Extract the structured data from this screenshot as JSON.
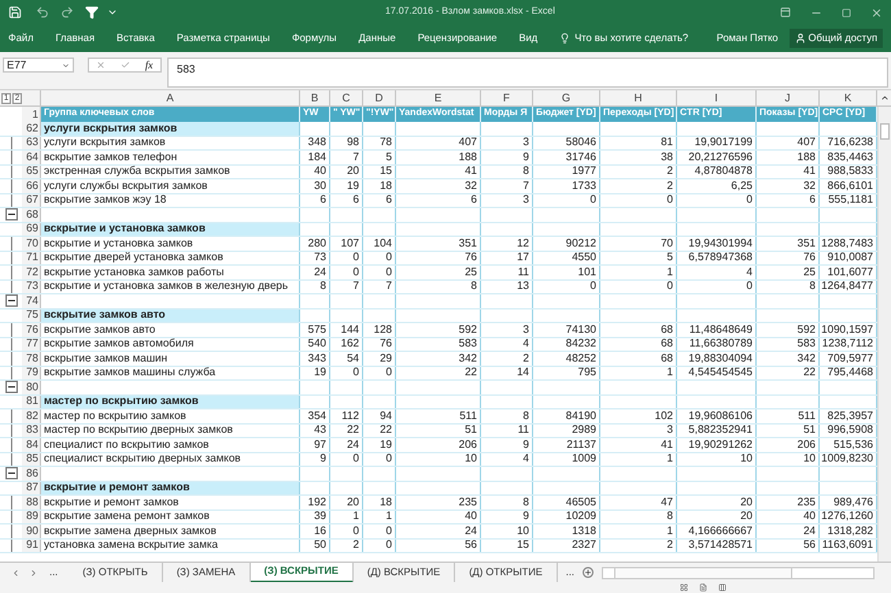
{
  "window": {
    "title": "17.07.2016 - Взлом замков.xlsx - Excel"
  },
  "ribbon": {
    "tabs": [
      "Файл",
      "Главная",
      "Вставка",
      "Разметка страницы",
      "Формулы",
      "Данные",
      "Рецензирование",
      "Вид"
    ],
    "tell_me": "Что вы хотите сделать?",
    "user": "Роман Пятко",
    "share": "Общий доступ"
  },
  "formula_bar": {
    "name_box": "E77",
    "function_label": "fx",
    "formula": "583"
  },
  "outline_levels": [
    "1",
    "2"
  ],
  "columns": [
    "A",
    "B",
    "C",
    "D",
    "E",
    "F",
    "G",
    "H",
    "I",
    "J",
    "K"
  ],
  "header_row": {
    "number": "1",
    "cells": [
      "Группа ключевых слов",
      "YW",
      "\" YW\"",
      "\"!YW\"",
      "YandexWordstat",
      "Морды Я",
      "Бюджет [YD]",
      "Переходы [YD]",
      "CTR [YD]",
      "Показы [YD]",
      "CPC [YD]"
    ]
  },
  "rows": [
    {
      "kind": "group",
      "number": "62",
      "cells": [
        "услуги вскрытия замков"
      ]
    },
    {
      "kind": "item",
      "number": "63",
      "cells": [
        "услуги вскрытия замков",
        "348",
        "98",
        "78",
        "407",
        "3",
        "58046",
        "81",
        "19,9017199",
        "407",
        "716,6238"
      ]
    },
    {
      "kind": "item",
      "number": "64",
      "cells": [
        "вскрытие замков телефон",
        "184",
        "7",
        "5",
        "188",
        "9",
        "31746",
        "38",
        "20,21276596",
        "188",
        "835,4463"
      ]
    },
    {
      "kind": "item",
      "number": "65",
      "cells": [
        "экстренная служба вскрытия замков",
        "40",
        "20",
        "15",
        "41",
        "8",
        "1977",
        "2",
        "4,87804878",
        "41",
        "988,5833"
      ]
    },
    {
      "kind": "item",
      "number": "66",
      "cells": [
        "услуги службы вскрытия замков",
        "30",
        "19",
        "18",
        "32",
        "7",
        "1733",
        "2",
        "6,25",
        "32",
        "866,6101"
      ]
    },
    {
      "kind": "item",
      "number": "67",
      "cells": [
        "вскрытие замков жэу 18",
        "6",
        "6",
        "6",
        "6",
        "3",
        "0",
        "0",
        "0",
        "6",
        "555,1181"
      ]
    },
    {
      "kind": "blank",
      "number": "68"
    },
    {
      "kind": "group",
      "number": "69",
      "cells": [
        "вскрытие и установка замков"
      ]
    },
    {
      "kind": "item",
      "number": "70",
      "cells": [
        "вскрытие и установка замков",
        "280",
        "107",
        "104",
        "351",
        "12",
        "90212",
        "70",
        "19,94301994",
        "351",
        "1288,7483"
      ]
    },
    {
      "kind": "item",
      "number": "71",
      "cells": [
        "вскрытие дверей установка замков",
        "73",
        "0",
        "0",
        "76",
        "17",
        "4550",
        "5",
        "6,578947368",
        "76",
        "910,0087"
      ]
    },
    {
      "kind": "item",
      "number": "72",
      "cells": [
        "вскрытие установка замков работы",
        "24",
        "0",
        "0",
        "25",
        "11",
        "101",
        "1",
        "4",
        "25",
        "101,6077"
      ]
    },
    {
      "kind": "item",
      "number": "73",
      "cells": [
        "вскрытие и установка замков в железную дверь",
        "8",
        "7",
        "7",
        "8",
        "13",
        "0",
        "0",
        "0",
        "8",
        "1264,8477"
      ]
    },
    {
      "kind": "blank",
      "number": "74"
    },
    {
      "kind": "group",
      "number": "75",
      "cells": [
        "вскрытие замков авто"
      ]
    },
    {
      "kind": "item",
      "number": "76",
      "cells": [
        "вскрытие замков авто",
        "575",
        "144",
        "128",
        "592",
        "3",
        "74130",
        "68",
        "11,48648649",
        "592",
        "1090,1597"
      ]
    },
    {
      "kind": "item",
      "number": "77",
      "cells": [
        "вскрытие замков автомобиля",
        "540",
        "162",
        "76",
        "583",
        "4",
        "84232",
        "68",
        "11,66380789",
        "583",
        "1238,7112"
      ]
    },
    {
      "kind": "item",
      "number": "78",
      "cells": [
        "вскрытие замков машин",
        "343",
        "54",
        "29",
        "342",
        "2",
        "48252",
        "68",
        "19,88304094",
        "342",
        "709,5977"
      ]
    },
    {
      "kind": "item",
      "number": "79",
      "cells": [
        "вскрытие замков машины служба",
        "19",
        "0",
        "0",
        "22",
        "14",
        "795",
        "1",
        "4,545454545",
        "22",
        "795,4468"
      ]
    },
    {
      "kind": "blank",
      "number": "80"
    },
    {
      "kind": "group",
      "number": "81",
      "cells": [
        "мастер по вскрытию замков"
      ]
    },
    {
      "kind": "item",
      "number": "82",
      "cells": [
        "мастер по вскрытию замков",
        "354",
        "112",
        "94",
        "511",
        "8",
        "84190",
        "102",
        "19,96086106",
        "511",
        "825,3957"
      ]
    },
    {
      "kind": "item",
      "number": "83",
      "cells": [
        "мастер по вскрытию дверных замков",
        "43",
        "22",
        "22",
        "51",
        "11",
        "2989",
        "3",
        "5,882352941",
        "51",
        "996,5908"
      ]
    },
    {
      "kind": "item",
      "number": "84",
      "cells": [
        "специалист по вскрытию замков",
        "97",
        "24",
        "19",
        "206",
        "9",
        "21137",
        "41",
        "19,90291262",
        "206",
        "515,536"
      ]
    },
    {
      "kind": "item",
      "number": "85",
      "cells": [
        "специалист вскрытию дверных замков",
        "9",
        "0",
        "0",
        "10",
        "4",
        "1009",
        "1",
        "10",
        "10",
        "1009,8230"
      ]
    },
    {
      "kind": "blank",
      "number": "86"
    },
    {
      "kind": "group",
      "number": "87",
      "cells": [
        "вскрытие и ремонт замков"
      ]
    },
    {
      "kind": "item",
      "number": "88",
      "cells": [
        "вскрытие и ремонт замков",
        "192",
        "20",
        "18",
        "235",
        "8",
        "46505",
        "47",
        "20",
        "235",
        "989,476"
      ]
    },
    {
      "kind": "item",
      "number": "89",
      "cells": [
        "вскрытие замена ремонт замков",
        "39",
        "1",
        "1",
        "40",
        "9",
        "10209",
        "8",
        "20",
        "40",
        "1276,1260"
      ]
    },
    {
      "kind": "item",
      "number": "90",
      "cells": [
        "вскрытие замена дверных замков",
        "16",
        "0",
        "0",
        "24",
        "10",
        "1318",
        "1",
        "4,166666667",
        "24",
        "1318,282"
      ]
    },
    {
      "kind": "item",
      "number": "91",
      "cells": [
        "установка замена вскрытие замка",
        "50",
        "2",
        "0",
        "56",
        "15",
        "2327",
        "2",
        "3,571428571",
        "56",
        "1163,6091"
      ]
    }
  ],
  "sheet_tabs": {
    "more_left": "...",
    "tabs": [
      {
        "label": "(З) ОТКРЫТЬ",
        "selected": false
      },
      {
        "label": "(З) ЗАМЕНА",
        "selected": false
      },
      {
        "label": "(З) ВСКРЫТИЕ",
        "selected": true
      },
      {
        "label": "(Д) ВСКРЫТИЕ",
        "selected": false
      },
      {
        "label": "(Д) ОТКРЫТИЕ",
        "selected": false
      }
    ],
    "more_right": "..."
  }
}
